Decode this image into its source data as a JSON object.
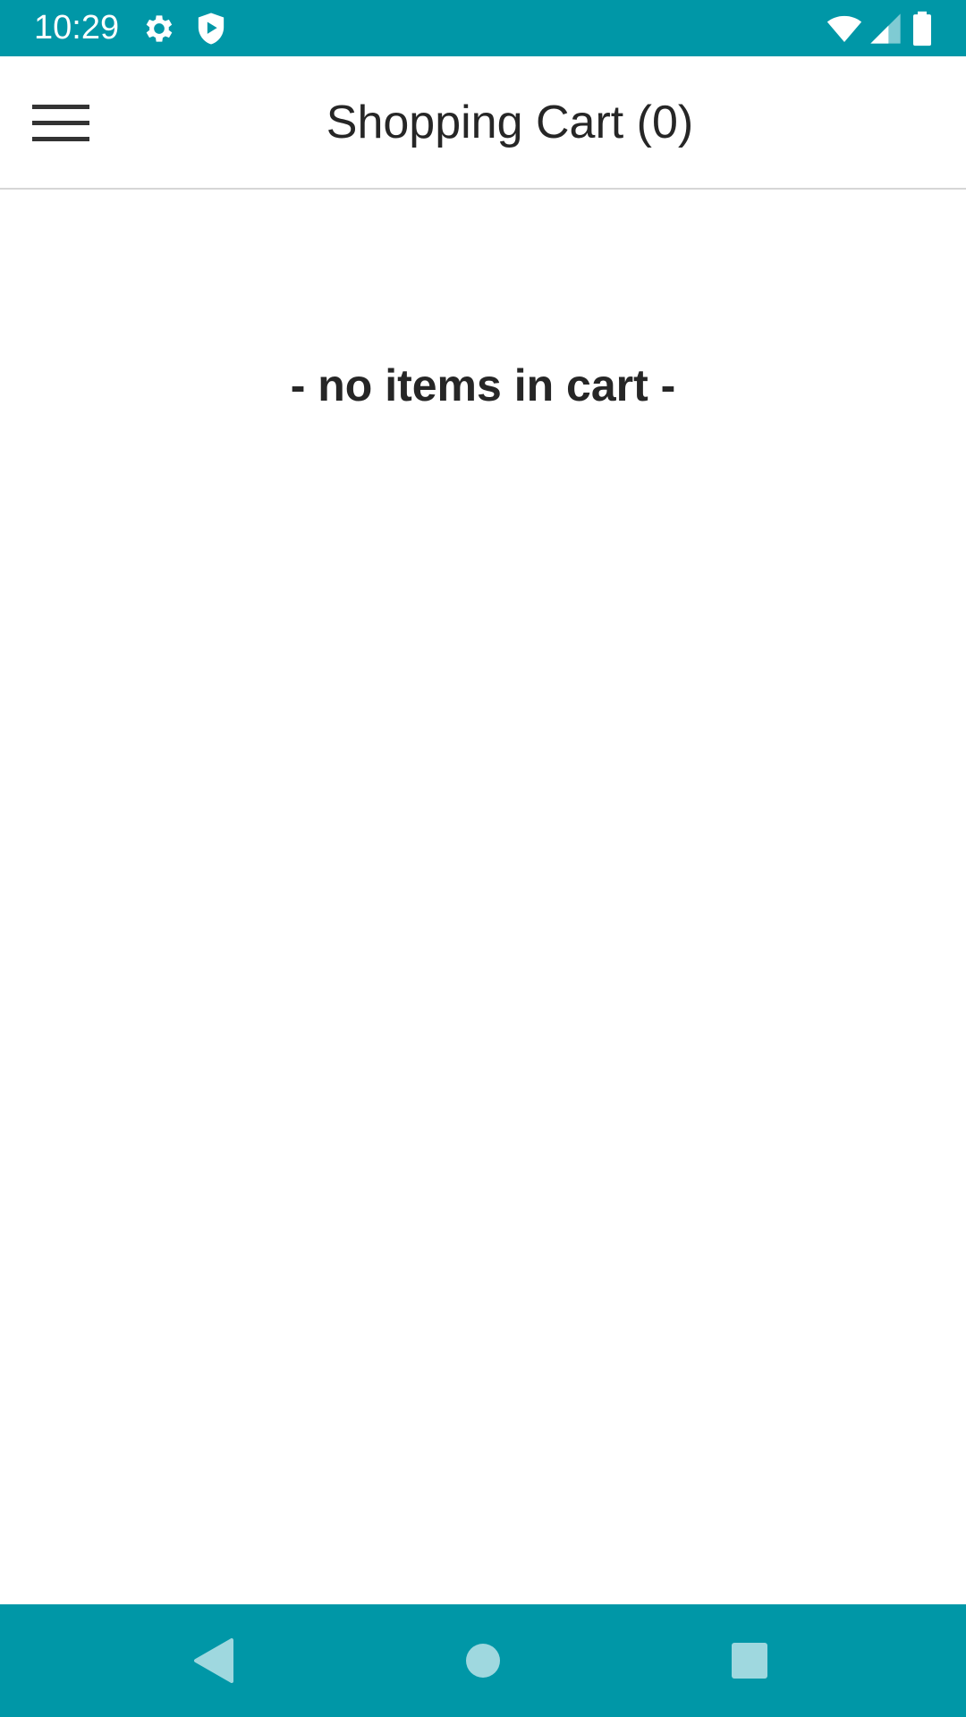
{
  "status_bar": {
    "time": "10:29",
    "background_color": "#0097a7",
    "left_icons": [
      "settings-gear-icon",
      "shield-play-icon"
    ],
    "right_icons": [
      "wifi-icon",
      "cellular-signal-icon",
      "battery-icon"
    ]
  },
  "toolbar": {
    "menu_icon": "hamburger-menu-icon",
    "title": "Shopping Cart (0)"
  },
  "cart": {
    "empty_message": "- no items in cart -"
  },
  "nav_bar": {
    "background_color": "#0097a7",
    "buttons": [
      "back-icon",
      "home-icon",
      "recents-icon"
    ]
  }
}
